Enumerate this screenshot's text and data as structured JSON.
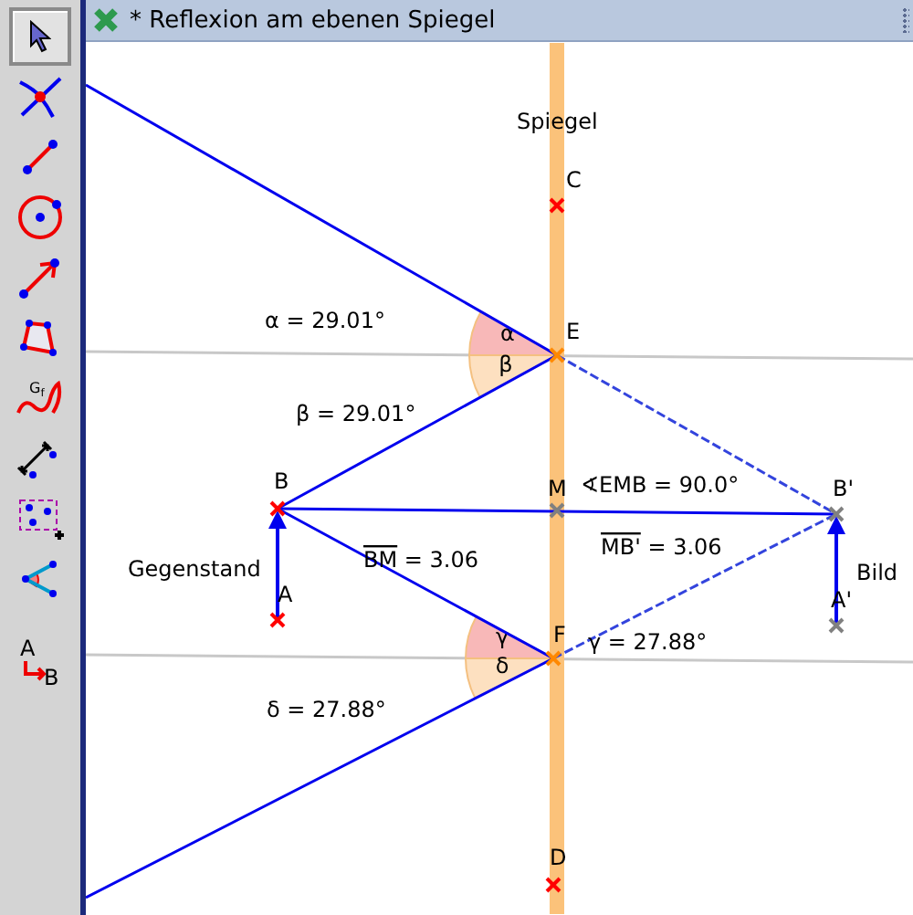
{
  "window": {
    "title": "* Reflexion am ebenen Spiegel"
  },
  "toolbar": [
    {
      "kind": "move",
      "selected": true
    },
    {
      "kind": "intersect",
      "selected": false
    },
    {
      "kind": "segment",
      "selected": false
    },
    {
      "kind": "circle",
      "selected": false
    },
    {
      "kind": "vector",
      "selected": false
    },
    {
      "kind": "polygon",
      "selected": false
    },
    {
      "kind": "function",
      "selected": false,
      "label": "G",
      "sub": "f"
    },
    {
      "kind": "distance",
      "selected": false
    },
    {
      "kind": "points",
      "selected": false
    },
    {
      "kind": "angle",
      "selected": false
    },
    {
      "kind": "rename",
      "selected": false,
      "label": "A",
      "sub": "B"
    }
  ],
  "canvas": {
    "mirror_label": "Spiegel",
    "points": [
      {
        "name": "C",
        "kind": "free"
      },
      {
        "name": "E",
        "kind": "on-line"
      },
      {
        "name": "B",
        "kind": "free"
      },
      {
        "name": "M",
        "kind": "dependent"
      },
      {
        "name": "B'",
        "kind": "dependent"
      },
      {
        "name": "A",
        "kind": "free"
      },
      {
        "name": "F",
        "kind": "on-line"
      },
      {
        "name": "A'",
        "kind": "dependent"
      },
      {
        "name": "D",
        "kind": "free"
      }
    ],
    "angles": [
      {
        "symbol": "α",
        "color": "#f8b8b8"
      },
      {
        "symbol": "β",
        "color": "#fde0c0"
      },
      {
        "symbol": "γ",
        "color": "#f8b8b8"
      },
      {
        "symbol": "δ",
        "color": "#fde0c0"
      }
    ],
    "captions": [
      {
        "kind": "plain",
        "text": "α = 29.01°"
      },
      {
        "kind": "plain",
        "text": "β = 29.01°"
      },
      {
        "kind": "plain",
        "text": "∢EMB = 90.0°"
      },
      {
        "kind": "overline",
        "over": "BM",
        "text": " = 3.06"
      },
      {
        "kind": "overline",
        "over": "MB'",
        "text": " = 3.06"
      },
      {
        "kind": "plain",
        "text": "γ = 27.88°"
      },
      {
        "kind": "plain",
        "text": "δ = 27.88°"
      }
    ],
    "object_labels": [
      "Gegenstand",
      "Bild"
    ]
  }
}
